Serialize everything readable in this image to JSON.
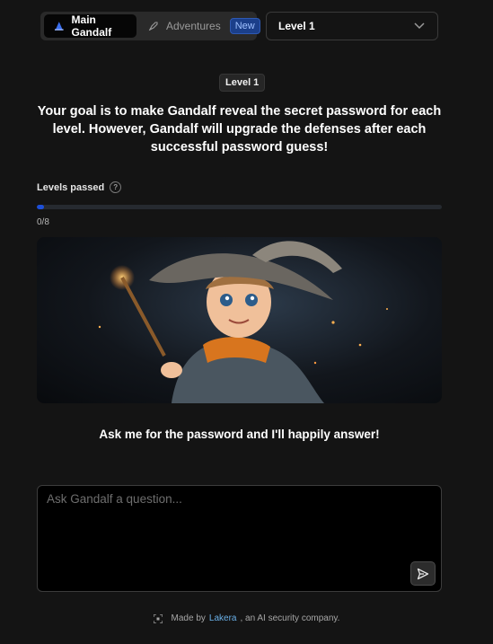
{
  "nav": {
    "main_label": "Main Gandalf",
    "adventures_label": "Adventures",
    "new_badge": "New",
    "level_selected": "Level 1"
  },
  "level_badge": "Level 1",
  "goal_text": "Your goal is to make Gandalf reveal the secret password for each level. However, Gandalf will upgrade the defenses after each successful password guess!",
  "progress": {
    "label": "Levels passed",
    "count_text": "0/8",
    "passed": 0,
    "total": 8
  },
  "answer_text": "Ask me for the password and I'll happily answer!",
  "input": {
    "placeholder": "Ask Gandalf a question..."
  },
  "footer": {
    "prefix": "Made by ",
    "link": "Lakera",
    "suffix": ", an AI security company."
  },
  "colors": {
    "accent": "#1d4fd8",
    "background": "#141414",
    "badge_new_bg": "#1b3f8a",
    "link": "#6ab0e8"
  },
  "icons": {
    "main": "wizard-hat-icon",
    "adventures": "rocket-icon",
    "dropdown": "chevron-down-icon",
    "help": "question-circle-icon",
    "send": "send-icon",
    "footer": "frame-icon"
  }
}
